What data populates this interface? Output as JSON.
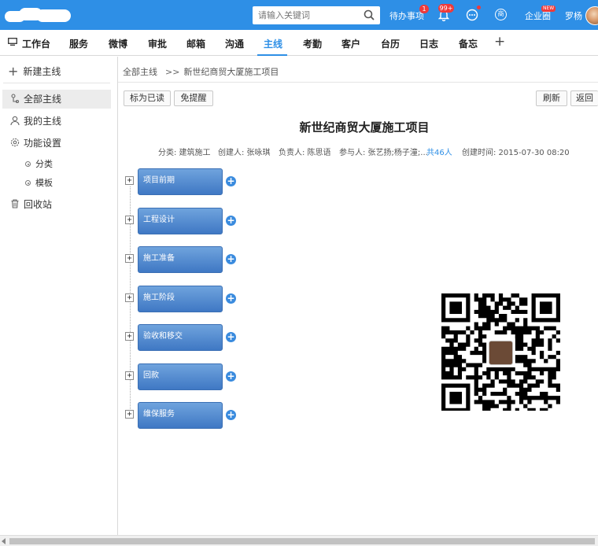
{
  "header": {
    "search_placeholder": "请输入关键词",
    "todo_label": "待办事项",
    "todo_badge": "1",
    "bell_badge": "99+",
    "shang_label": "商",
    "enterprise_label": "企业圈",
    "new_tag": "NEW",
    "user_name": "罗杨",
    "accent": "#2e8fe6"
  },
  "nav": {
    "items": [
      "工作台",
      "服务",
      "微博",
      "审批",
      "邮箱",
      "沟通",
      "主线",
      "考勤",
      "客户",
      "台历",
      "日志",
      "备忘"
    ],
    "active": "主线",
    "add_label": "+"
  },
  "sidebar": {
    "new_label": "新建主线",
    "items": [
      "全部主线",
      "我的主线",
      "功能设置"
    ],
    "sub_items": [
      "分类",
      "模板"
    ],
    "recycle": "回收站"
  },
  "breadcrumb": {
    "root": "全部主线",
    "sep": ">>",
    "current": "新世纪商贸大厦施工项目"
  },
  "toolbar": {
    "mark_read": "标为已读",
    "no_remind": "免提醒",
    "refresh": "刷新",
    "back": "返回"
  },
  "project": {
    "title": "新世纪商贸大厦施工项目",
    "category": "分类: 建筑施工",
    "creator": "创建人: 张咏琪",
    "owner": "负责人: 陈思语",
    "participants": "参与人: 张艺扬;杨子潼;...",
    "participant_count": "共46人",
    "created": "创建时间: 2015-07-30 08:20"
  },
  "tree": {
    "expand_symbol": "+",
    "add_symbol": "+",
    "nodes": [
      "项目前期",
      "工程设计",
      "施工准备",
      "施工阶段",
      "验收和移交",
      "回款",
      "维保服务"
    ]
  }
}
